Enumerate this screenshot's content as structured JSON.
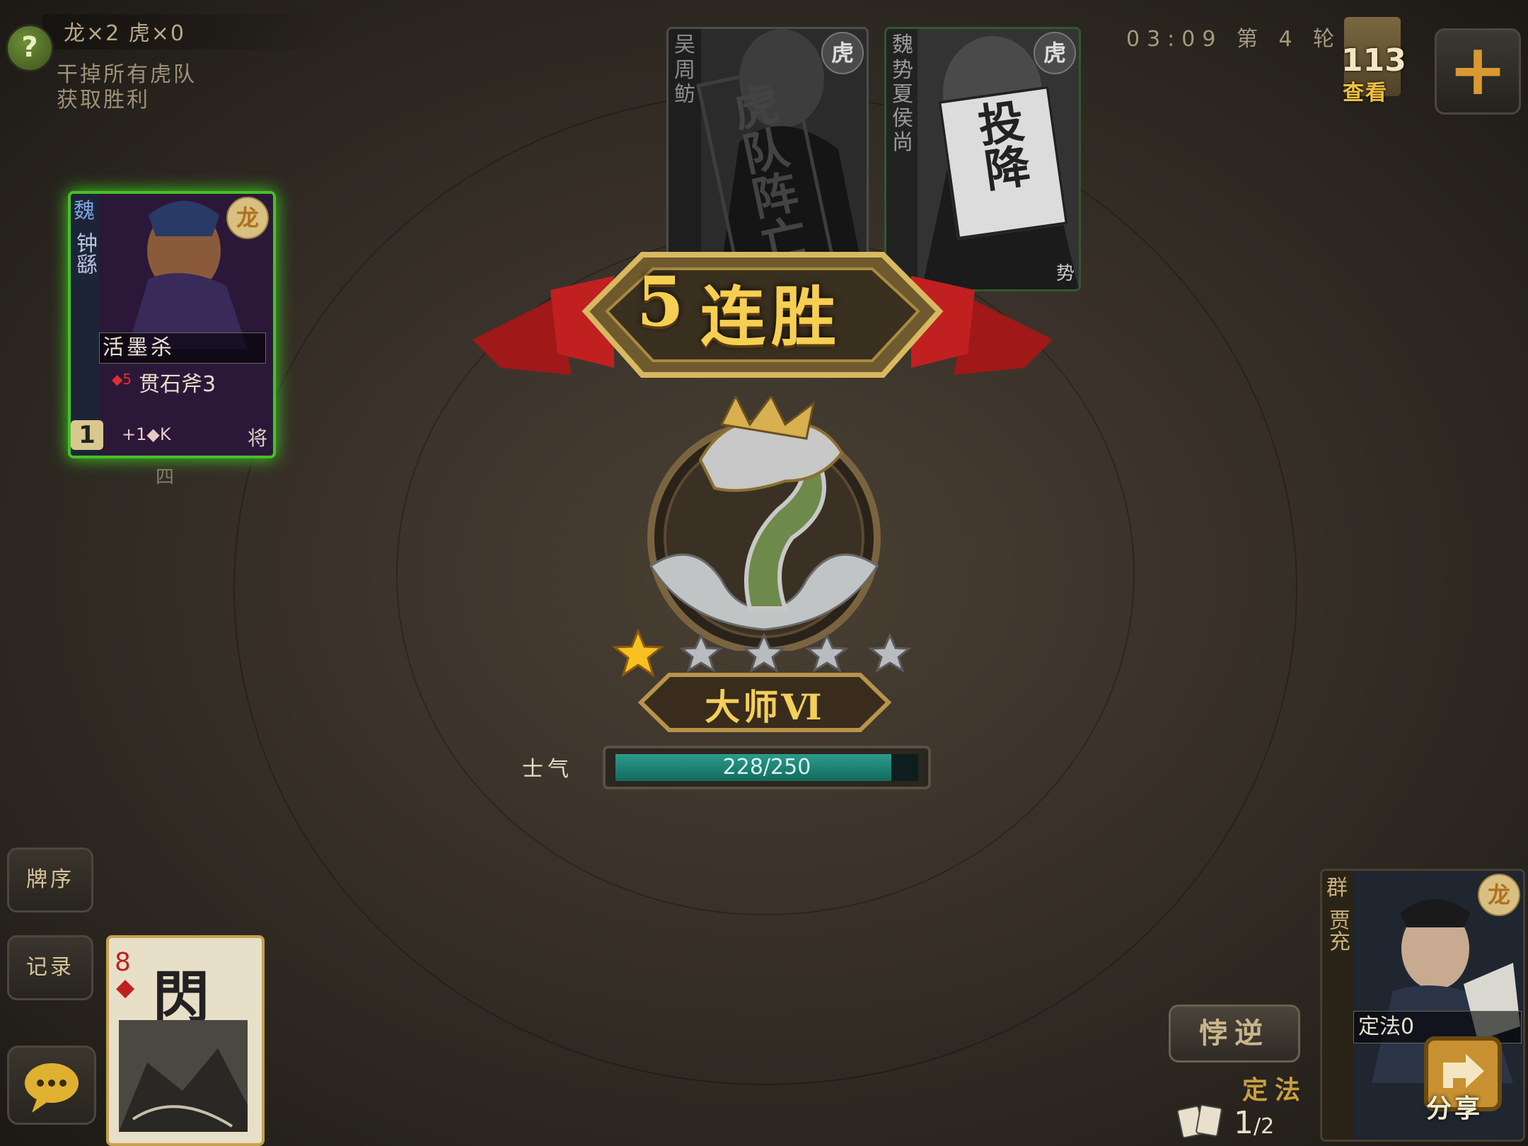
{
  "status": {
    "score_text": "龙×2 虎×0",
    "objective_line1": "干掉所有虎队",
    "objective_line2": "获取胜利"
  },
  "top_bar": {
    "timer_round": "03:09 第 4 轮",
    "deck_count": "113",
    "deck_view_label": "查看",
    "plus_symbol": "+"
  },
  "enemies": [
    {
      "faction": "吴",
      "name": "周鲂",
      "badge": "虎",
      "stamp": "虎队阵亡"
    },
    {
      "faction": "魏",
      "name": "势夏侯尚",
      "badge": "虎",
      "stamp": "投降",
      "corner": "势"
    }
  ],
  "self_card": {
    "faction": "魏",
    "name": "钟繇",
    "badge": "龙",
    "skill": "活墨杀",
    "equip": "贯石斧3",
    "equip_suit_num": "◆5",
    "hp": "1",
    "extra": "+1◆K",
    "role": "将",
    "seat": "四"
  },
  "overlay": {
    "streak_number": "5",
    "streak_text": "连胜",
    "rank": "大师Ⅵ",
    "stars_filled": 1,
    "stars_total": 5,
    "morale_label": "士气",
    "morale_text": "228/250",
    "morale_fraction": 0.912
  },
  "left_buttons": {
    "order": "牌序",
    "record": "记录"
  },
  "hand_card": {
    "rank": "8",
    "suit": "◆",
    "name": "閃"
  },
  "player_card": {
    "faction": "群",
    "name": "贾充",
    "badge": "龙",
    "skill": "定法0"
  },
  "bottom_right": {
    "rebel_btn": "悖逆",
    "law_label": "定法",
    "page_current": "1",
    "page_total": "/2",
    "share_label": "分享"
  },
  "colors": {
    "accent_gold": "#f2cf5a",
    "morale_fill": "#2c9a8c",
    "self_glow": "#48c028"
  }
}
